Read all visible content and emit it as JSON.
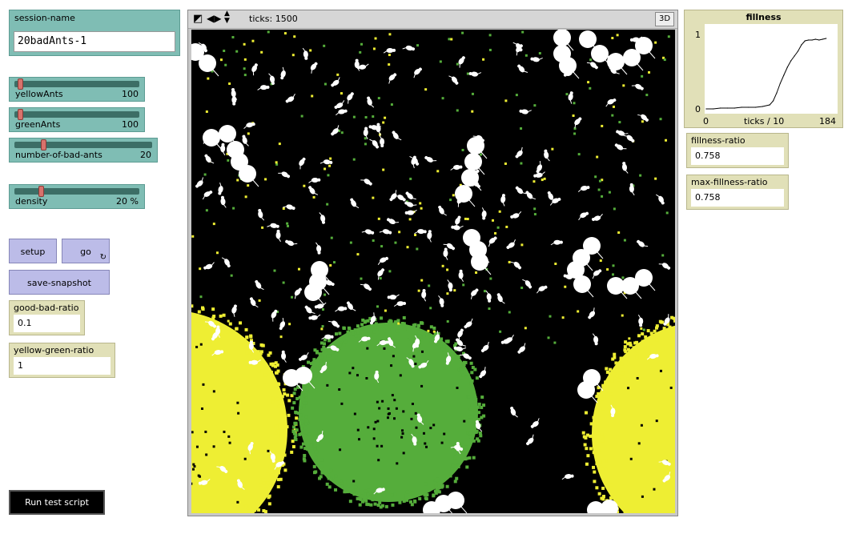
{
  "session": {
    "label": "session-name",
    "value": "20badAnts-1"
  },
  "sliders": [
    {
      "name": "yellowAnts",
      "value": "100",
      "fraction": 0.03
    },
    {
      "name": "greenAnts",
      "value": "100",
      "fraction": 0.03
    },
    {
      "name": "number-of-bad-ants",
      "value": "20",
      "fraction": 0.2
    },
    {
      "name": "density",
      "value": "20 %",
      "fraction": 0.2
    }
  ],
  "buttons": {
    "setup": "setup",
    "go": "go",
    "snapshot": "save-snapshot",
    "run_test": "Run test script"
  },
  "inputs": {
    "good_bad": {
      "label": "good-bad-ratio",
      "value": "0.1"
    },
    "yellow_green": {
      "label": "yellow-green-ratio",
      "value": "1"
    }
  },
  "view": {
    "ticks": "ticks: 1500",
    "three_d": "3D"
  },
  "plot": {
    "title": "fillness",
    "ymax": "1",
    "ymin": "0",
    "xmin": "0",
    "xmax": "184",
    "xlabel": "ticks / 10"
  },
  "monitors": {
    "fillness": {
      "label": "fillness-ratio",
      "value": "0.758"
    },
    "max_fillness": {
      "label": "max-fillness-ratio",
      "value": "0.758"
    }
  },
  "colors": {
    "teal": "#7fbdb4",
    "button_lavender": "#bcbce8",
    "monitor_khaki": "#e1e0b8",
    "patch_yellow": "#eeee33",
    "patch_green": "#55ad3b"
  },
  "chart_data": {
    "type": "line",
    "title": "fillness",
    "xlabel": "ticks / 10",
    "ylabel": "",
    "xlim": [
      0,
      184
    ],
    "ylim": [
      0,
      1
    ],
    "series": [
      {
        "x": [
          0,
          10,
          20,
          30,
          40,
          50,
          60,
          70,
          80,
          90,
          95,
          100,
          105,
          110,
          115,
          120,
          125,
          130,
          135,
          140,
          145,
          150,
          155,
          160,
          165,
          170
        ],
        "y": [
          0.0,
          0.0,
          0.01,
          0.01,
          0.01,
          0.02,
          0.02,
          0.02,
          0.03,
          0.05,
          0.1,
          0.2,
          0.32,
          0.42,
          0.52,
          0.6,
          0.66,
          0.72,
          0.8,
          0.85,
          0.86,
          0.86,
          0.87,
          0.86,
          0.87,
          0.88
        ]
      }
    ]
  }
}
